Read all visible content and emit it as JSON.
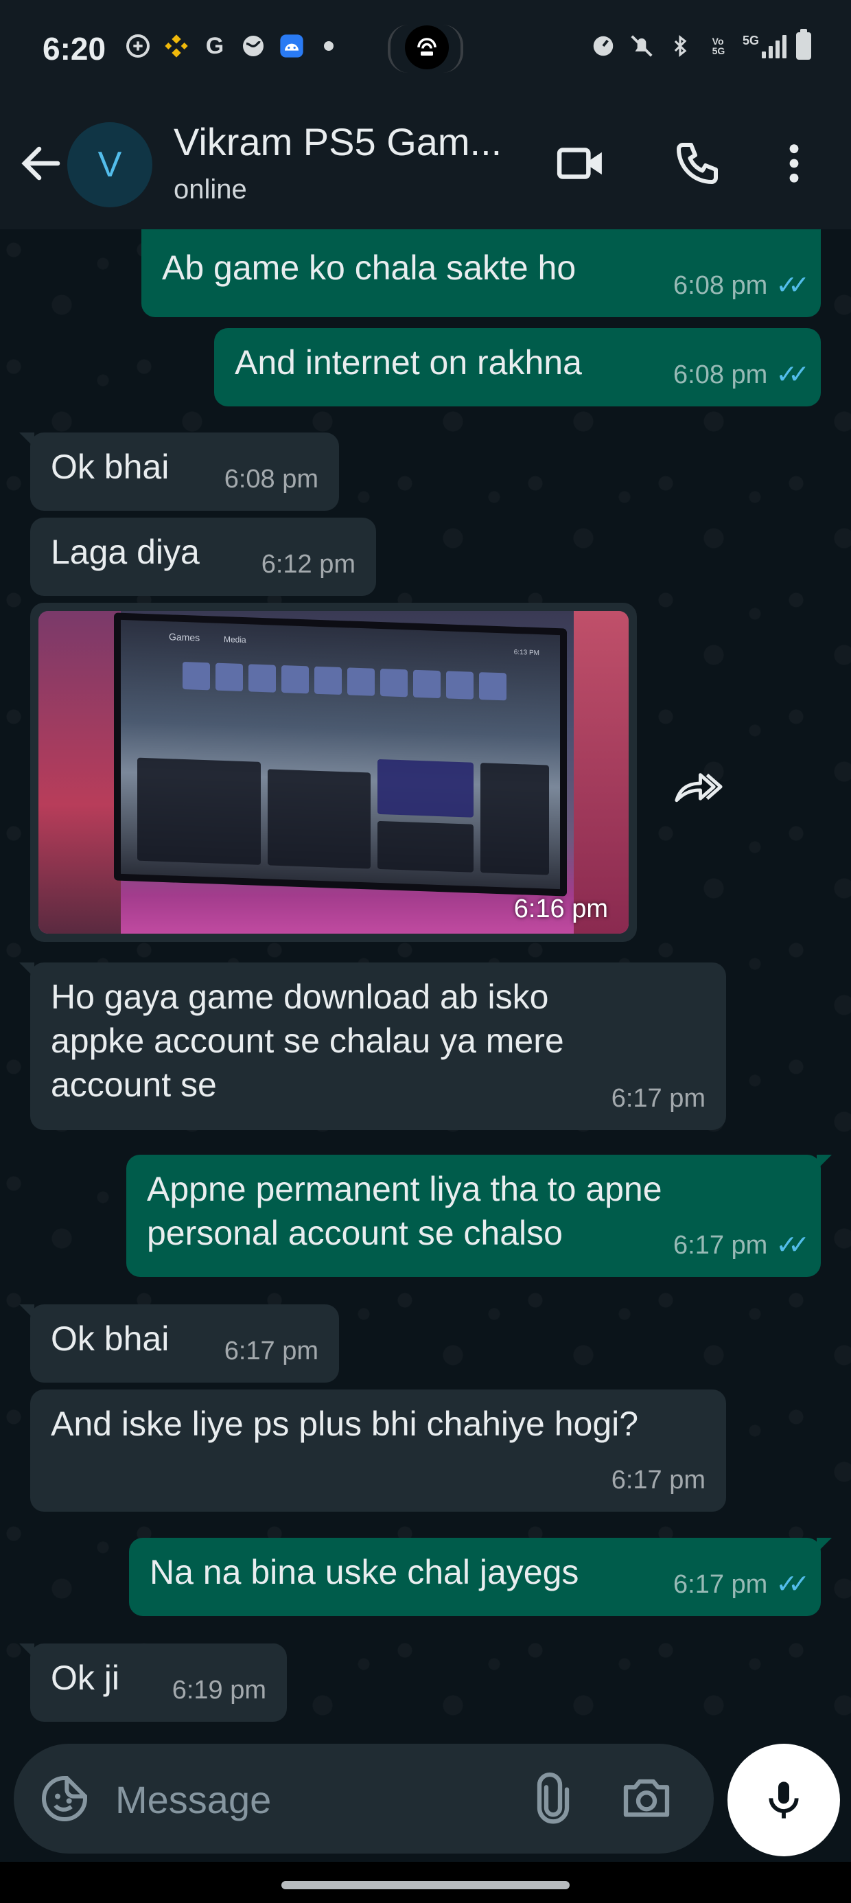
{
  "status_bar": {
    "time": "6:20",
    "network_label": "5G"
  },
  "header": {
    "avatar_initial": "V",
    "contact_name": "Vikram PS5 Gam...",
    "contact_status": "online"
  },
  "messages": [
    {
      "direction": "out",
      "text": "Ab game ko chala sakte ho",
      "time": "6:08 pm",
      "ticks": "✓✓"
    },
    {
      "direction": "out",
      "text": "And internet on rakhna",
      "time": "6:08 pm",
      "ticks": "✓✓"
    },
    {
      "direction": "in",
      "text": "Ok bhai",
      "time": "6:08 pm"
    },
    {
      "direction": "in",
      "text": "Laga diya",
      "time": "6:12 pm"
    },
    {
      "direction": "in",
      "type": "image",
      "time": "6:16 pm"
    },
    {
      "direction": "in",
      "text": "Ho gaya game download ab isko appke account se chalau ya mere account se",
      "time": "6:17 pm"
    },
    {
      "direction": "out",
      "text": "Appne permanent liya tha to apne personal account se chalso",
      "time": "6:17 pm",
      "ticks": "✓✓"
    },
    {
      "direction": "in",
      "text": "Ok bhai",
      "time": "6:17 pm"
    },
    {
      "direction": "in",
      "text": "And iske liye ps plus bhi chahiye hogi?",
      "time": "6:17 pm"
    },
    {
      "direction": "out",
      "text": "Na na bina uske chal jayegs",
      "time": "6:17 pm",
      "ticks": "✓✓"
    },
    {
      "direction": "in",
      "text": "Ok ji",
      "time": "6:19 pm"
    }
  ],
  "photo_screen": {
    "tab_games": "Games",
    "tab_media": "Media",
    "clock": "6:13 PM"
  },
  "composer": {
    "placeholder": "Message"
  },
  "icons": {
    "back": "arrow-left-icon",
    "video": "video-camera-icon",
    "call": "phone-icon",
    "more": "more-vert-icon",
    "forward": "forward-icon",
    "emoji": "emoji-sticker-icon",
    "attach": "paperclip-icon",
    "camera": "camera-icon",
    "mic": "microphone-icon"
  },
  "colors": {
    "background": "#0b141a",
    "header": "#121b22",
    "outgoing_bubble": "#005c4b",
    "incoming_bubble": "#202c33",
    "read_ticks": "#53bdeb"
  }
}
